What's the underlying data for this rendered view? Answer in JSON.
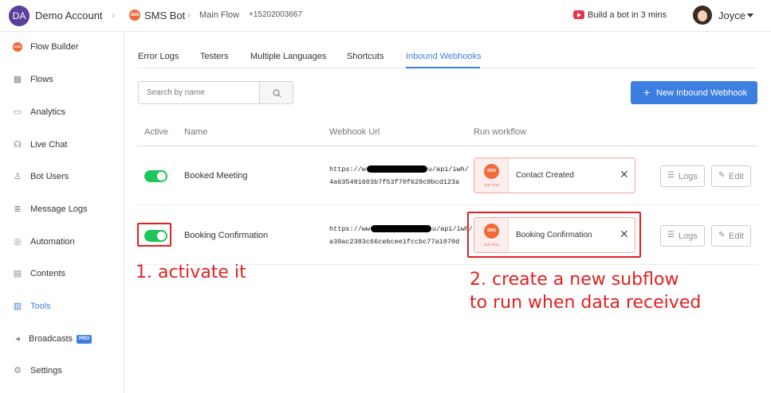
{
  "topbar": {
    "account_initials": "DA",
    "account_name": "Demo Account",
    "bot_icon_text": "SMS",
    "bot_name": "SMS Bot",
    "flow_name": "Main Flow",
    "phone": "+15202003667",
    "build_bot_link": "Build a bot in 3 mins",
    "user_name": "Joyce"
  },
  "sidebar": {
    "items": [
      {
        "label": "Flow Builder",
        "icon": "sms-icon"
      },
      {
        "label": "Flows",
        "icon": "grid-icon"
      },
      {
        "label": "Analytics",
        "icon": "chart-icon"
      },
      {
        "label": "Live Chat",
        "icon": "headset-icon"
      },
      {
        "label": "Bot Users",
        "icon": "user-icon"
      },
      {
        "label": "Message Logs",
        "icon": "database-icon"
      },
      {
        "label": "Automation",
        "icon": "automation-icon"
      },
      {
        "label": "Contents",
        "icon": "document-icon"
      },
      {
        "label": "Tools",
        "icon": "tools-icon",
        "active": true
      },
      {
        "label": "Broadcasts",
        "icon": "megaphone-icon",
        "badge": "PRO"
      },
      {
        "label": "Settings",
        "icon": "gear-icon"
      }
    ]
  },
  "tabs": [
    {
      "label": "Error Logs"
    },
    {
      "label": "Testers"
    },
    {
      "label": "Multiple Languages"
    },
    {
      "label": "Shortcuts"
    },
    {
      "label": "Inbound Webhooks",
      "active": true
    }
  ],
  "search": {
    "placeholder": "Search by name"
  },
  "new_webhook_button": "New Inbound Webhook",
  "table": {
    "headers": {
      "active": "Active",
      "name": "Name",
      "url": "Webhook Url",
      "workflow": "Run workflow"
    },
    "rows": [
      {
        "active": true,
        "name": "Booked Meeting",
        "url_prefix": "https://w",
        "url_suffix": "u/api/iwh/",
        "url_line2": "4a635491603b7f53f70f628c8bcd123a",
        "workflow_icon": "SMS",
        "workflow_sub": "Sub Flow",
        "workflow": "Contact Created",
        "logs_label": "Logs",
        "edit_label": "Edit"
      },
      {
        "active": true,
        "name": "Booking Confirmation",
        "url_prefix": "https://ww",
        "url_suffix": "u/api/iwh/",
        "url_line2": "a30ac2383c66cebcee1fccbc77a1070d",
        "workflow_icon": "SMS",
        "workflow_sub": "Sub Flow",
        "workflow": "Booking Confirmation",
        "logs_label": "Logs",
        "edit_label": "Edit"
      }
    ]
  },
  "annotations": {
    "step1": "1. activate it",
    "step2_line1": "2. create a new subflow",
    "step2_line2": "to run when data received"
  },
  "colors": {
    "accent": "#3d7fe0",
    "toggle_on": "#1ec55a",
    "annotation": "#e41e1e",
    "sms_brand": "#f06a3a"
  }
}
